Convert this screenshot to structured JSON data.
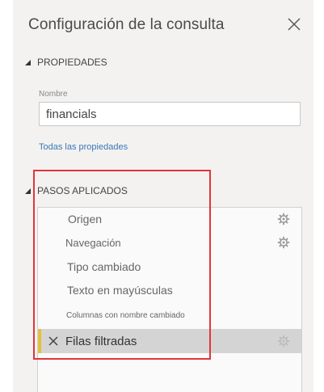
{
  "panel": {
    "title": "Configuración de la consulta",
    "close_icon": "close-icon"
  },
  "properties": {
    "header": "PROPIEDADES",
    "name_label": "Nombre",
    "name_value": "financials",
    "all_properties_link": "Todas las propiedades"
  },
  "applied_steps": {
    "header": "PASOS APLICADOS",
    "items": [
      {
        "label": "Origen",
        "has_gear": true,
        "active": false
      },
      {
        "label": "Navegación",
        "has_gear": true,
        "active": false
      },
      {
        "label": "Tipo cambiado",
        "has_gear": false,
        "active": false
      },
      {
        "label": "Texto en mayúsculas",
        "has_gear": false,
        "active": false
      },
      {
        "label": "Columnas con nombre cambiado",
        "has_gear": false,
        "active": false
      },
      {
        "label": "Filas filtradas",
        "has_gear": true,
        "active": true
      }
    ]
  },
  "colors": {
    "panel_bg": "#f3f2f1",
    "link": "#3a78b8",
    "active_step_bg": "#d4d4d4",
    "active_step_marker": "#e3c13b",
    "annotation_box": "#e0353b"
  }
}
